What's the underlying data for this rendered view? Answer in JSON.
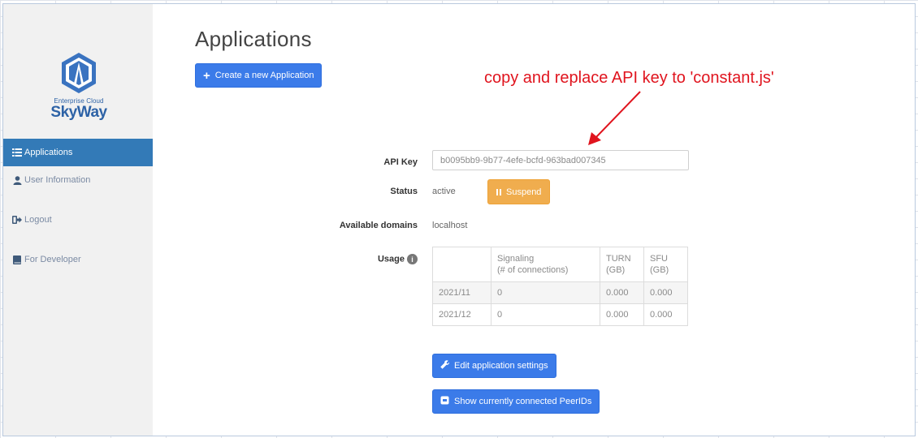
{
  "logo": {
    "subtitle": "Enterprise Cloud",
    "name": "SkyWay"
  },
  "sidebar": {
    "items": [
      {
        "label": "Applications",
        "icon": "list-icon",
        "active": true
      },
      {
        "label": "User Information",
        "icon": "user-icon",
        "active": false
      },
      {
        "label": "Logout",
        "icon": "logout-icon",
        "active": false
      },
      {
        "label": "For Developer",
        "icon": "book-icon",
        "active": false
      }
    ]
  },
  "main": {
    "title": "Applications",
    "create_button": "Create a new Application",
    "annotation": "copy and replace API key to 'constant.js'",
    "api_key_label": "API Key",
    "api_key_value": "b0095bb9-9b77-4efe-bcfd-963bad007345",
    "status_label": "Status",
    "status_value": "active",
    "suspend_button": "Suspend",
    "domains_label": "Available domains",
    "domains_value": "localhost",
    "usage_label": "Usage",
    "usage_table": {
      "headers": [
        "",
        "Signaling\n(# of connections)",
        "TURN\n(GB)",
        "SFU\n(GB)"
      ],
      "rows": [
        [
          "2021/11",
          "0",
          "0.000",
          "0.000"
        ],
        [
          "2021/12",
          "0",
          "0.000",
          "0.000"
        ]
      ]
    },
    "edit_button": "Edit application settings",
    "peer_button": "Show currently connected PeerIDs"
  },
  "colors": {
    "primary": "#3b7be9",
    "active_nav": "#337ab7",
    "warning": "#f0ad4e",
    "annotation": "#e0141e",
    "logo_blue": "#2d62a6"
  }
}
